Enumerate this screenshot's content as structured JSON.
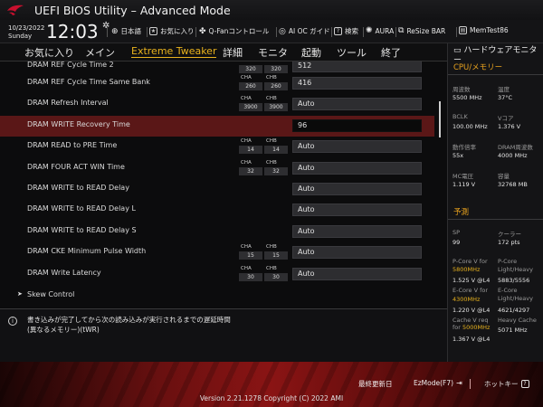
{
  "app": {
    "title": "UEFI BIOS Utility – Advanced Mode"
  },
  "infobar": {
    "date": "10/23/2022",
    "day": "Sunday",
    "time": "12:03",
    "tools": [
      {
        "icon": "globe-icon",
        "label": "日本語"
      },
      {
        "icon": "star-icon",
        "label": "お気に入り"
      },
      {
        "icon": "fan-icon",
        "label": "Q-Fanコントロール"
      },
      {
        "icon": "ai-oc-icon",
        "label": "AI OC ガイド"
      },
      {
        "icon": "question-icon",
        "label": "検索"
      },
      {
        "icon": "aura-icon",
        "label": "AURA"
      },
      {
        "icon": "resize-bar-icon",
        "label": "ReSize BAR"
      },
      {
        "icon": "memtest-icon",
        "label": "MemTest86"
      }
    ]
  },
  "menu": {
    "items": [
      "お気に入り",
      "メイン",
      "Extreme Tweaker",
      "詳細",
      "モニタ",
      "起動",
      "ツール",
      "終了"
    ],
    "active": 2
  },
  "rows": [
    {
      "label": "DRAM REF Cycle Time 2",
      "cha_label": "",
      "cha": "320",
      "chb_label": "",
      "chb": "320",
      "value": "512"
    },
    {
      "label": "DRAM REF Cycle Time Same Bank",
      "cha_label": "CHA",
      "cha": "260",
      "chb_label": "CHB",
      "chb": "260",
      "value": "416"
    },
    {
      "label": "DRAM Refresh Interval",
      "cha_label": "CHA",
      "cha": "3900",
      "chb_label": "CHB",
      "chb": "3900",
      "value": "Auto"
    },
    {
      "label": "DRAM WRITE Recovery Time",
      "cha_label": "",
      "cha": "",
      "chb_label": "",
      "chb": "",
      "value": "96"
    },
    {
      "label": "DRAM READ to PRE Time",
      "cha_label": "CHA",
      "cha": "14",
      "chb_label": "CHB",
      "chb": "14",
      "value": "Auto"
    },
    {
      "label": "DRAM FOUR ACT WIN Time",
      "cha_label": "CHA",
      "cha": "32",
      "chb_label": "CHB",
      "chb": "32",
      "value": "Auto"
    },
    {
      "label": "DRAM WRITE to READ Delay",
      "cha_label": "",
      "cha": "",
      "chb_label": "",
      "chb": "",
      "value": "Auto"
    },
    {
      "label": "DRAM WRITE to READ Delay L",
      "cha_label": "",
      "cha": "",
      "chb_label": "",
      "chb": "",
      "value": "Auto"
    },
    {
      "label": "DRAM WRITE to READ Delay S",
      "cha_label": "",
      "cha": "",
      "chb_label": "",
      "chb": "",
      "value": "Auto"
    },
    {
      "label": "DRAM CKE Minimum Pulse Width",
      "cha_label": "CHA",
      "cha": "15",
      "chb_label": "CHB",
      "chb": "15",
      "value": "Auto"
    },
    {
      "label": "DRAM Write Latency",
      "cha_label": "CHA",
      "cha": "30",
      "chb_label": "CHB",
      "chb": "30",
      "value": "Auto"
    }
  ],
  "submenu": {
    "label": "Skew Control"
  },
  "help": {
    "text": "書き込みが完了してから次の読み込みが実行されるまでの遅延時間\n(異なるメモリー)(tWR)"
  },
  "hwmonitor": {
    "title": "ハードウェアモニター",
    "cpu_section": "CPU/メモリー",
    "cpu": [
      {
        "l1": "周波数",
        "v1": "5500 MHz",
        "l2": "温度",
        "v2": "37°C"
      },
      {
        "l1": "BCLK",
        "v1": "100.00 MHz",
        "l2": "Vコア",
        "v2": "1.376 V"
      },
      {
        "l1": "動作倍率",
        "v1": "55x",
        "l2": "DRAM周波数",
        "v2": "4000 MHz"
      },
      {
        "l1": "MC電圧",
        "v1": "1.119 V",
        "l2": "容量",
        "v2": "32768 MB"
      }
    ],
    "predict_section": "予測",
    "sp_label": "SP",
    "sp_value": "99",
    "cooler_label": "クーラー",
    "cooler_value": "172 pts",
    "pcore_label": "P-Core V for",
    "pcore_freq": "5800MHz",
    "pcore_value": "1.525 V @L4",
    "pcore_lh_label": "P-Core\nLight/Heavy",
    "pcore_lh_value": "5883/5556",
    "ecore_label": "E-Core V for",
    "ecore_freq": "4300MHz",
    "ecore_value": "1.220 V @L4",
    "ecore_lh_label": "E-Core\nLight/Heavy",
    "ecore_lh_value": "4621/4297",
    "cache_label": "Cache V req\nfor",
    "cache_freq": "5000MHz",
    "cache_value": "1.367 V @L4",
    "heavy_cache_label": "Heavy Cache",
    "heavy_cache_value": "5071 MHz"
  },
  "bottom": {
    "last_modified": "最終更新日",
    "ezmode": "EzMode(F7)",
    "hotkeys": "ホットキー",
    "copyright": "Version 2.21.1278 Copyright (C) 2022 AMI"
  }
}
